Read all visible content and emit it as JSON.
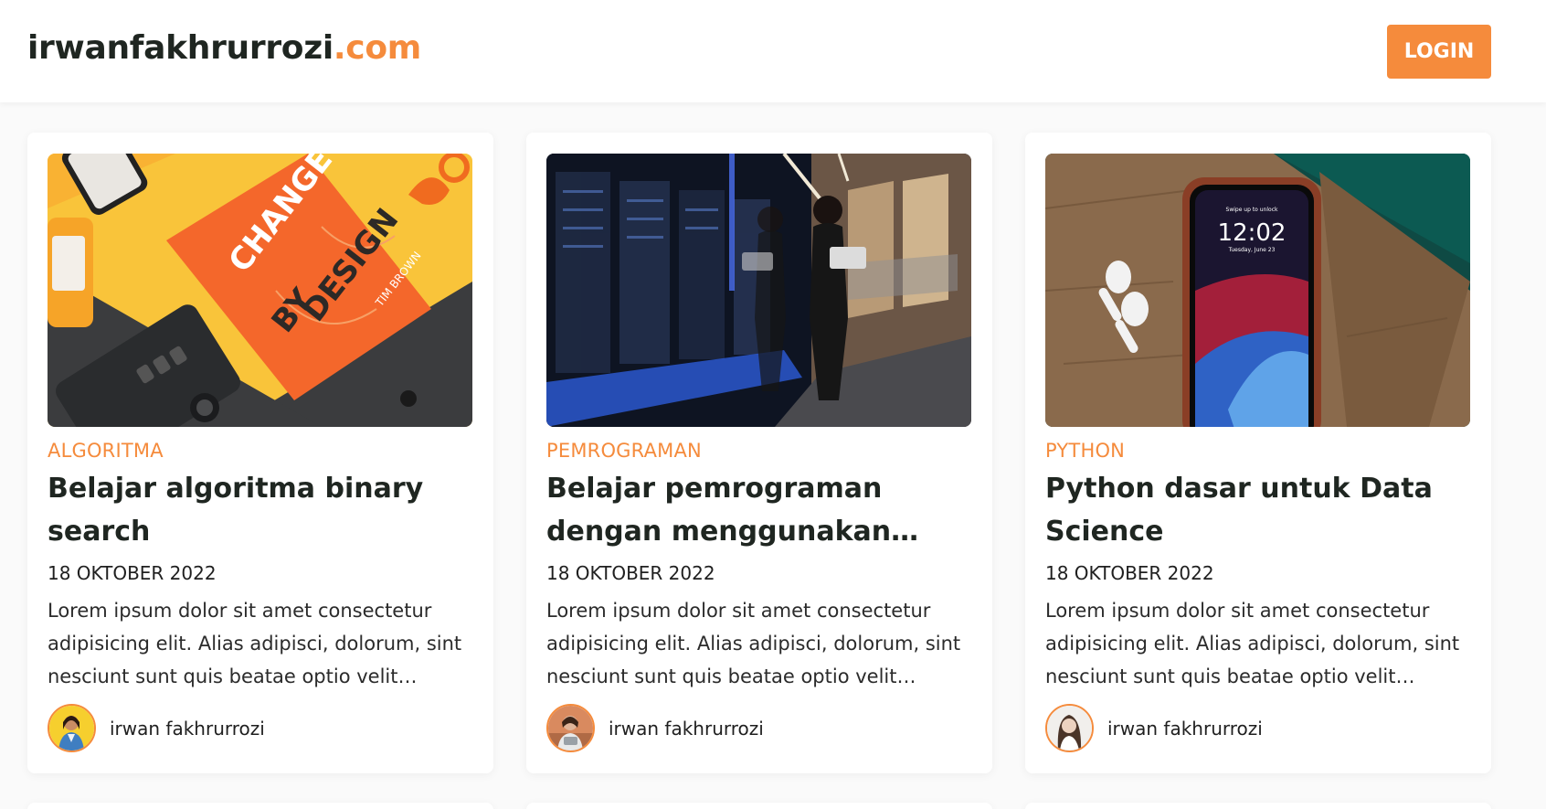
{
  "site": {
    "brand_name": "irwanfakhrurrozi",
    "brand_tld": ".com",
    "accent_color": "#f58b3c"
  },
  "header": {
    "login_label": "LOGIN"
  },
  "posts": [
    {
      "category": "ALGORITMA",
      "title": "Belajar algoritma binary search",
      "date": "18 OKTOBER 2022",
      "excerpt": "Lorem ipsum dolor sit amet consectetur adipisicing elit. Alias adipisci, dolorum, sint nesciunt sunt quis beatae optio velit…",
      "author": "irwan fakhrurrozi",
      "image_text": {
        "line1": "CHANGE",
        "line2": "BY",
        "line3": "DESIGN",
        "author_on_book": "TIM BROWN"
      }
    },
    {
      "category": "PEMROGRAMAN",
      "title": "Belajar pemrograman dengan menggunakan…",
      "date": "18 OKTOBER 2022",
      "excerpt": "Lorem ipsum dolor sit amet consectetur adipisicing elit. Alias adipisci, dolorum, sint nesciunt sunt quis beatae optio velit…",
      "author": "irwan fakhrurrozi"
    },
    {
      "category": "PYTHON",
      "title": "Python dasar untuk Data Science",
      "date": "18 OKTOBER 2022",
      "excerpt": "Lorem ipsum dolor sit amet consectetur adipisicing elit. Alias adipisci, dolorum, sint nesciunt sunt quis beatae optio velit…",
      "author": "irwan fakhrurrozi",
      "image_text": {
        "clock": "12:02",
        "date": "Tuesday, June 23",
        "unlock": "Swipe up to unlock"
      }
    }
  ]
}
